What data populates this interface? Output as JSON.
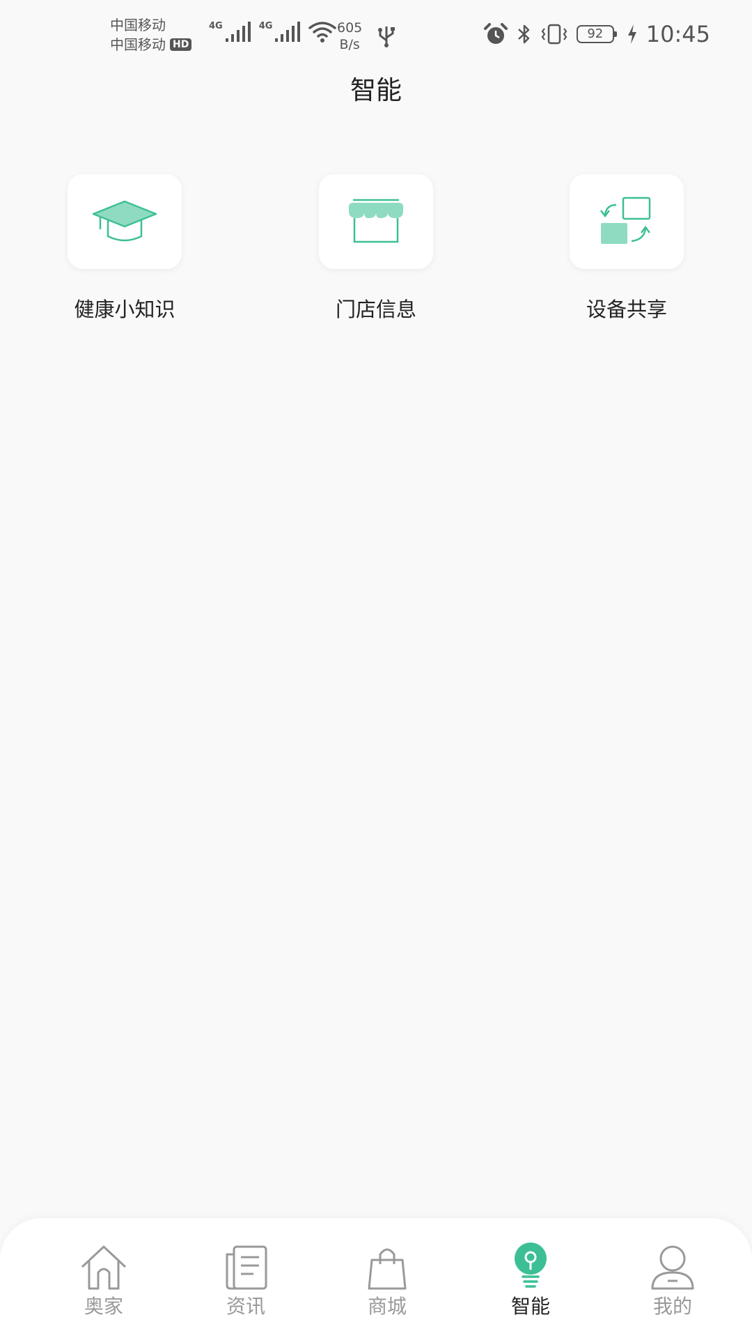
{
  "status_bar": {
    "carrier_1": "中国移动",
    "carrier_2": "中国移动",
    "hd_badge": "HD",
    "signal_1_type": "4G",
    "signal_2_type": "4G",
    "net_speed_value": "605",
    "net_speed_unit": "B/s",
    "battery_level": "92",
    "time": "10:45"
  },
  "header": {
    "title": "智能"
  },
  "features": [
    {
      "label": "健康小知识",
      "icon": "graduation-cap-icon"
    },
    {
      "label": "门店信息",
      "icon": "storefront-icon"
    },
    {
      "label": "设备共享",
      "icon": "share-swap-icon"
    }
  ],
  "bottom_nav": {
    "active_index": 3,
    "items": [
      {
        "label": "奥家",
        "icon": "home-icon"
      },
      {
        "label": "资讯",
        "icon": "news-icon"
      },
      {
        "label": "商城",
        "icon": "shopping-bag-icon"
      },
      {
        "label": "智能",
        "icon": "lightbulb-icon"
      },
      {
        "label": "我的",
        "icon": "user-icon"
      }
    ]
  },
  "colors": {
    "accent": "#3dbf96",
    "accent_light": "#8edbc1",
    "inactive": "#999999",
    "background": "#f9f9f9"
  }
}
